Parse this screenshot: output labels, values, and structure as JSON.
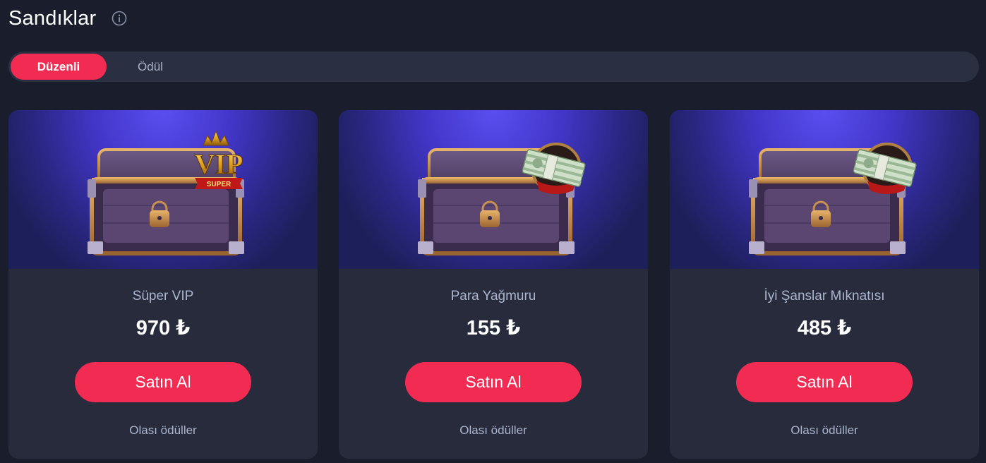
{
  "page": {
    "title": "Sandıklar",
    "info_icon": "info-circle-icon"
  },
  "tabs": [
    {
      "label": "Düzenli",
      "active": true
    },
    {
      "label": "Ödül",
      "active": false
    }
  ],
  "colors": {
    "accent": "#f12b52",
    "background": "#1a1d2b",
    "card": "#272b3c",
    "muted_text": "#aab6cf"
  },
  "cards": [
    {
      "name": "Süper VIP",
      "price": "970 ₺",
      "buy_label": "Satın Al",
      "rewards_label": "Olası ödüller",
      "badge": "VIP",
      "badge_sub": "SUPER",
      "image_icon": "vip-chest-icon"
    },
    {
      "name": "Para Yağmuru",
      "price": "155 ₺",
      "buy_label": "Satın Al",
      "rewards_label": "Olası ödüller",
      "image_icon": "money-chest-icon"
    },
    {
      "name": "İyi Şanslar Mıknatısı",
      "price": "485 ₺",
      "buy_label": "Satın Al",
      "rewards_label": "Olası ödüller",
      "image_icon": "money-chest-icon"
    }
  ]
}
